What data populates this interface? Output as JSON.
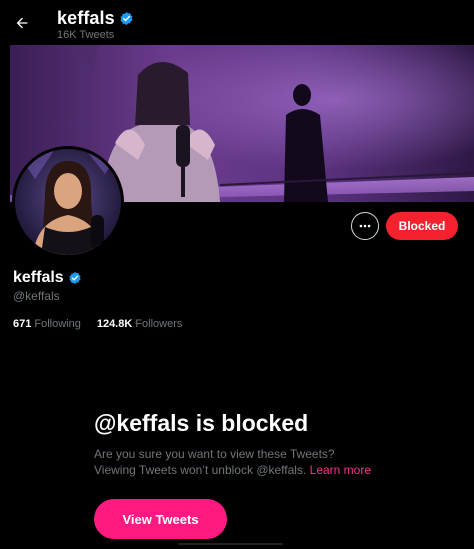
{
  "header": {
    "name": "keffals",
    "tweet_count": "16K Tweets"
  },
  "profile": {
    "name": "keffals",
    "handle": "@keffals",
    "following_count": "671",
    "following_label": "Following",
    "followers_count": "124.8K",
    "followers_label": "Followers"
  },
  "actions": {
    "blocked_label": "Blocked"
  },
  "blocked_notice": {
    "title": "@keffals is blocked",
    "line1": "Are you sure you want to view these Tweets?",
    "line2": "Viewing Tweets won’t unblock @keffals.",
    "link": "Learn more",
    "button": "View Tweets"
  },
  "icons": {
    "back": "arrow-left-icon",
    "verified": "verified-badge-icon",
    "more": "more-horizontal-icon"
  },
  "colors": {
    "blocked_button": "#f4212e",
    "view_button": "#ff1a82",
    "link": "#ff2d92",
    "verified": "#1d9bf0"
  }
}
